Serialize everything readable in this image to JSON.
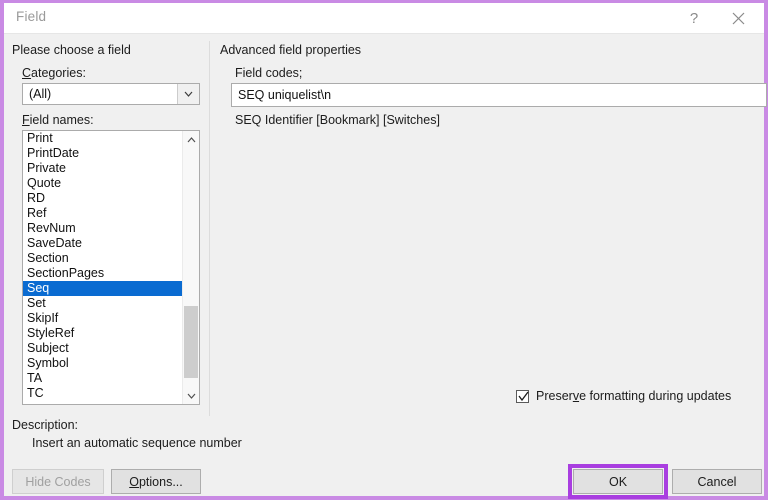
{
  "window": {
    "title": "Field",
    "help_icon": "question-mark-icon",
    "close_icon": "close-icon"
  },
  "left_panel": {
    "group_label": "Please choose a field",
    "categories": {
      "label": "Categories:",
      "accelerator": "C",
      "selected": "(All)",
      "dropdown_icon": "chevron-down-icon"
    },
    "field_names": {
      "label": "Field names:",
      "accelerator": "F",
      "items": [
        "Print",
        "PrintDate",
        "Private",
        "Quote",
        "RD",
        "Ref",
        "RevNum",
        "SaveDate",
        "Section",
        "SectionPages",
        "Seq",
        "Set",
        "SkipIf",
        "StyleRef",
        "Subject",
        "Symbol",
        "TA",
        "TC"
      ],
      "selected": "Seq",
      "selected_index": 10,
      "scroll_up_icon": "chevron-up-icon",
      "scroll_down_icon": "chevron-down-icon"
    }
  },
  "right_panel": {
    "group_label": "Advanced field properties",
    "field_codes": {
      "label": "Field codes;",
      "value": "SEQ uniquelist\\n"
    },
    "syntax_hint": "SEQ Identifier [Bookmark] [Switches]",
    "preserve_formatting": {
      "label": "Preserve formatting during updates",
      "accelerator": "v",
      "checked": true,
      "check_icon": "checkmark-icon"
    }
  },
  "description": {
    "label": "Description:",
    "text": "Insert an automatic sequence number"
  },
  "buttons": {
    "hide_codes": {
      "label": "Hide Codes",
      "enabled": false
    },
    "options": {
      "label": "Options...",
      "accelerator": "O"
    },
    "ok": {
      "label": "OK",
      "highlighted": true
    },
    "cancel": {
      "label": "Cancel"
    }
  },
  "colors": {
    "dialog_border": "#c98ae4",
    "highlight_box": "#a93ee0",
    "selection_blue": "#0a6bd1",
    "body_background": "#f0f0f0"
  }
}
